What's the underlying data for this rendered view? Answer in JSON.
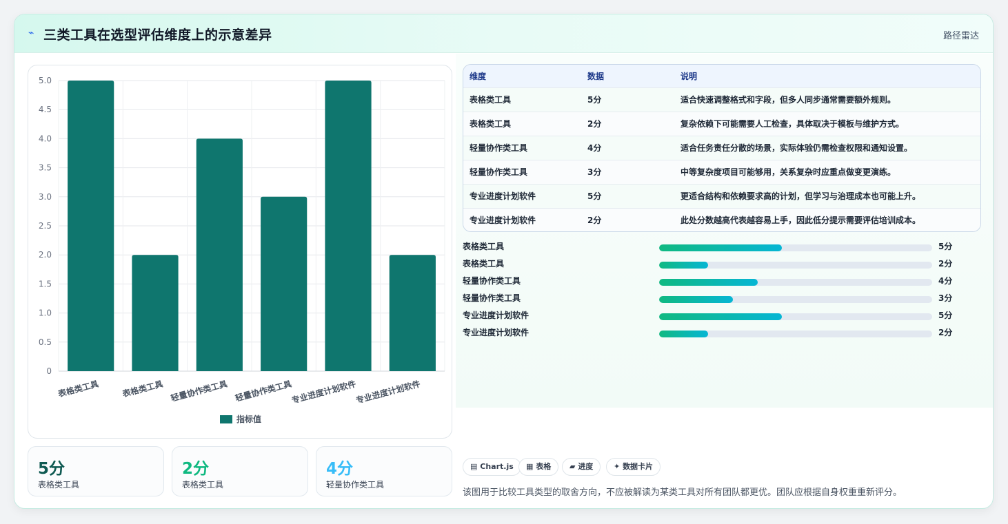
{
  "header": {
    "icon": "bolt-icon",
    "title": "三类工具在选型评估维度上的示意差异",
    "tag": "路径雷达"
  },
  "chart_data": {
    "type": "bar",
    "categories": [
      "表格类工具",
      "表格类工具",
      "轻量协作类工具",
      "轻量协作类工具",
      "专业进度计划软件",
      "专业进度计划软件"
    ],
    "series": [
      {
        "name": "指标值",
        "values": [
          5,
          2,
          4,
          3,
          5,
          2
        ],
        "color": "#0f766e"
      }
    ],
    "ylim": [
      0,
      5
    ],
    "yticks": [
      "0",
      "0.5",
      "1.0",
      "1.5",
      "2.0",
      "2.5",
      "3.0",
      "3.5",
      "4.0",
      "4.5",
      "5.0"
    ],
    "legend_position": "bottom",
    "grid": true
  },
  "table": {
    "headers": [
      "维度",
      "数据",
      "说明"
    ],
    "rows": [
      [
        "表格类工具",
        "5分",
        "适合快速调整格式和字段，但多人同步通常需要额外规则。"
      ],
      [
        "表格类工具",
        "2分",
        "复杂依赖下可能需要人工检查，具体取决于模板与维护方式。"
      ],
      [
        "轻量协作类工具",
        "4分",
        "适合任务责任分散的场景，实际体验仍需检查权限和通知设置。"
      ],
      [
        "轻量协作类工具",
        "3分",
        "中等复杂度项目可能够用，关系复杂时应重点做变更演练。"
      ],
      [
        "专业进度计划软件",
        "5分",
        "更适合结构和依赖要求高的计划，但学习与治理成本也可能上升。"
      ],
      [
        "专业进度计划软件",
        "2分",
        "此处分数越高代表越容易上手，因此低分提示需要评估培训成本。"
      ]
    ]
  },
  "progress": [
    {
      "label": "表格类工具",
      "value": "5分",
      "fraction": 0.45
    },
    {
      "label": "表格类工具",
      "value": "2分",
      "fraction": 0.18
    },
    {
      "label": "轻量协作类工具",
      "value": "4分",
      "fraction": 0.36
    },
    {
      "label": "轻量协作类工具",
      "value": "3分",
      "fraction": 0.27
    },
    {
      "label": "专业进度计划软件",
      "value": "5分",
      "fraction": 0.45
    },
    {
      "label": "专业进度计划软件",
      "value": "2分",
      "fraction": 0.18
    }
  ],
  "stats": [
    {
      "value": "5分",
      "label": "表格类工具",
      "color": "#0f5a52"
    },
    {
      "value": "2分",
      "label": "表格类工具",
      "color": "#10b981"
    },
    {
      "value": "4分",
      "label": "轻量协作类工具",
      "color": "#38bdf8"
    }
  ],
  "chips": [
    {
      "icon": "▤",
      "label": "Chart.js"
    },
    {
      "icon": "▦",
      "label": "表格"
    },
    {
      "icon": "▰",
      "label": "进度"
    },
    {
      "icon": "✦",
      "label": "数据卡片"
    }
  ],
  "note": "该图用于比较工具类型的取舍方向，不应被解读为某类工具对所有团队都更优。团队应根据自身权重重新评分。"
}
